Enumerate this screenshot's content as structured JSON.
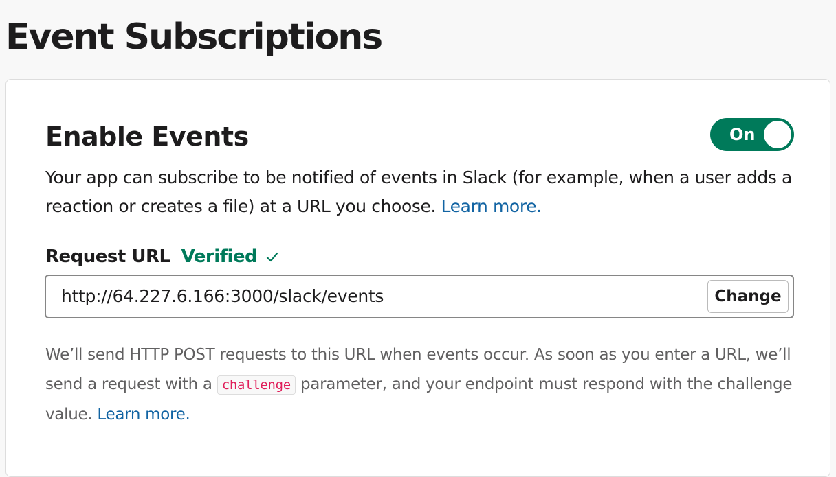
{
  "page": {
    "title": "Event Subscriptions"
  },
  "enable_events": {
    "title": "Enable Events",
    "toggle_label": "On",
    "toggle_state": "on",
    "description": "Your app can subscribe to be notified of events in Slack (for example, when a user adds a reaction or creates a file) at a URL you choose.",
    "learn_more": "Learn more."
  },
  "request_url": {
    "label": "Request URL",
    "status": "Verified",
    "status_icon": "check-icon",
    "value": "http://64.227.6.166:3000/slack/events",
    "change_label": "Change"
  },
  "help": {
    "text_before": "We’ll send HTTP POST requests to this URL when events occur. As soon as you enter a URL, we’ll send a request with a",
    "code": "challenge",
    "text_after": "parameter, and your endpoint must respond with the challenge value.",
    "learn_more": "Learn more."
  },
  "colors": {
    "accent_green": "#007a5a",
    "link_blue": "#1264a3",
    "code_red": "#e01e5a"
  }
}
